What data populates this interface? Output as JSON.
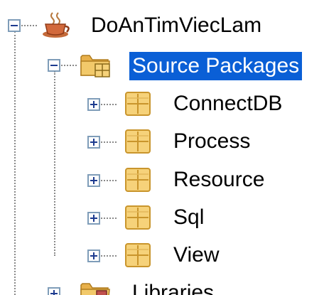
{
  "tree": {
    "project": {
      "label": "DoAnTimViecLam",
      "icon": "coffee-cup-project-icon",
      "expanded": true
    },
    "source_packages": {
      "label": "Source Packages",
      "icon": "source-folder-icon",
      "expanded": true,
      "selected": true
    },
    "packages": [
      {
        "label": "ConnectDB",
        "icon": "package-icon",
        "expanded": false
      },
      {
        "label": "Process",
        "icon": "package-icon",
        "expanded": false
      },
      {
        "label": "Resource",
        "icon": "package-icon",
        "expanded": false
      },
      {
        "label": "Sql",
        "icon": "package-icon",
        "expanded": false
      },
      {
        "label": "View",
        "icon": "package-icon",
        "expanded": false
      }
    ],
    "libraries": {
      "label": "Libraries",
      "icon": "libraries-folder-icon",
      "expanded": false
    }
  },
  "colors": {
    "selection": "#0a5fd6",
    "toggle_border": "#7f9db9",
    "toggle_sign": "#1d3b8f",
    "package_fill": "#f6d27a",
    "package_line": "#c9952c",
    "folder_fill": "#f2c96a"
  }
}
